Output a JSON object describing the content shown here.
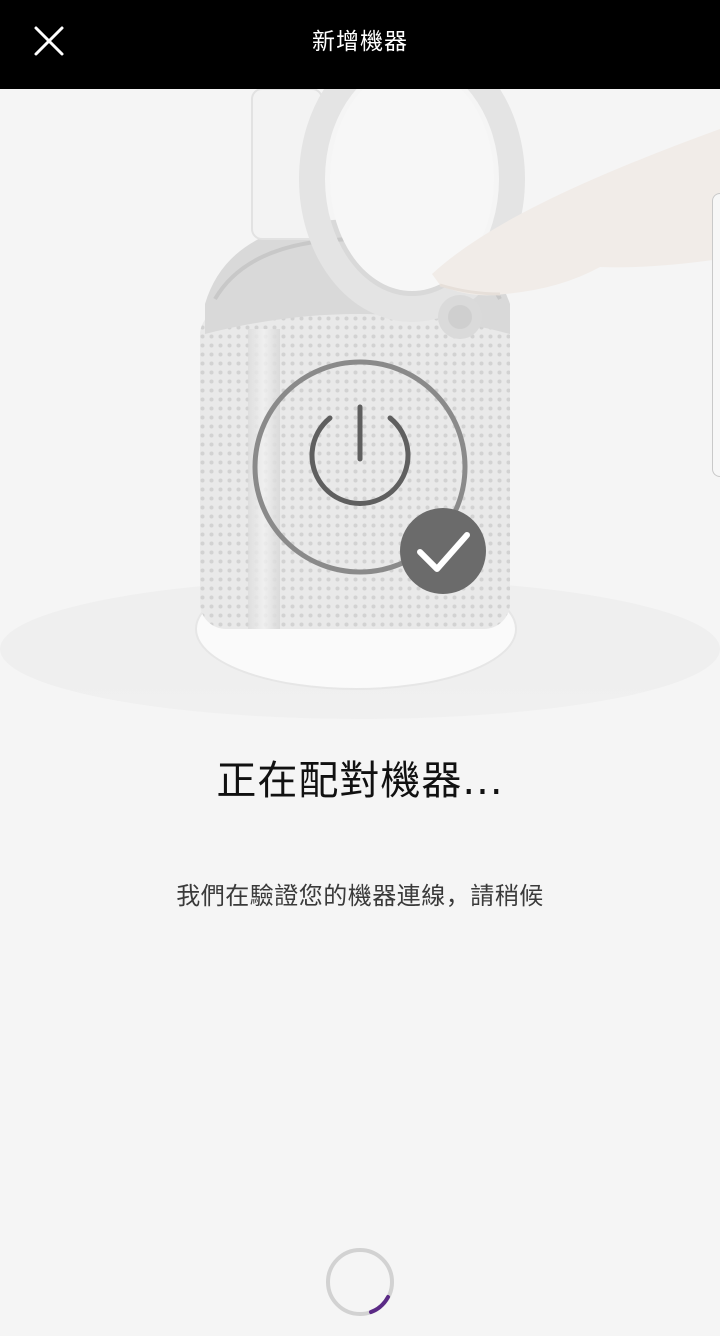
{
  "header": {
    "title": "新增機器",
    "close_icon": "close-icon"
  },
  "hero": {
    "image": "purifier-fan-with-hand",
    "overlay_icon": "power-icon",
    "status_icon": "checkmark-icon"
  },
  "main": {
    "title": "正在配對機器...",
    "subtitle": "我們在驗證您的機器連線，請稍候"
  },
  "loading": {
    "icon": "spinner-icon",
    "accent_color": "#5b2a86"
  },
  "colors": {
    "header_bg": "#000000",
    "page_bg": "#f5f5f5",
    "ring_gray": "#7a7a7a",
    "check_badge": "#6b6b6b"
  }
}
